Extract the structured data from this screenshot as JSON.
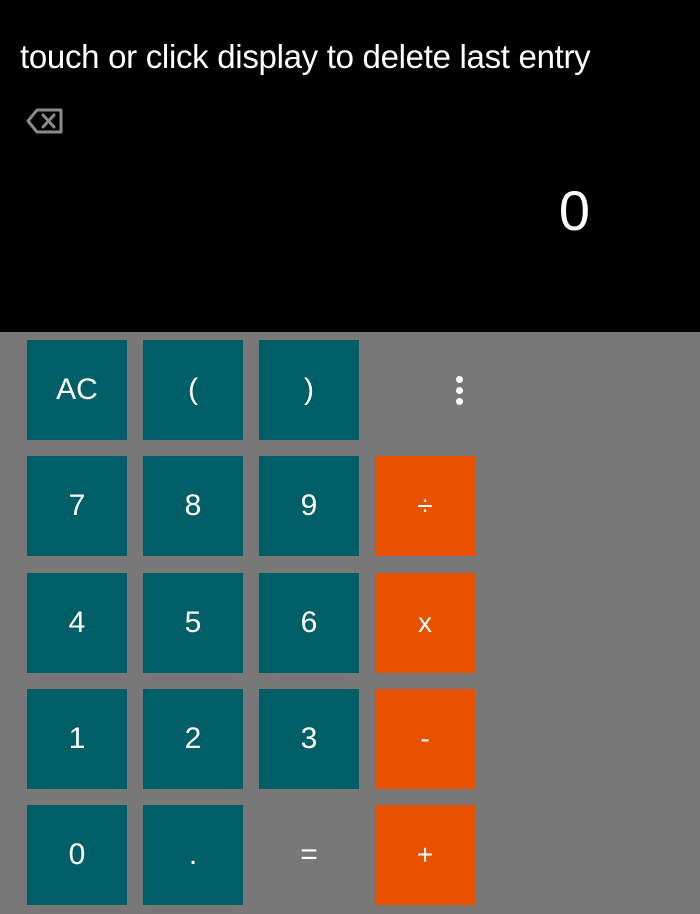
{
  "display": {
    "hint": "touch or click display to delete last entry",
    "value": "0",
    "backspace_icon": "backspace-icon"
  },
  "keys": {
    "ac": "AC",
    "open_paren": "(",
    "close_paren": ")",
    "menu_icon": "more-vert-icon",
    "seven": "7",
    "eight": "8",
    "nine": "9",
    "divide": "÷",
    "four": "4",
    "five": "5",
    "six": "6",
    "multiply": "x",
    "one": "1",
    "two": "2",
    "three": "3",
    "minus": "-",
    "zero": "0",
    "decimal": ".",
    "equals": "=",
    "plus": "+"
  },
  "colors": {
    "display_bg": "#000000",
    "keypad_bg": "#787878",
    "number_key": "#005f66",
    "operator_key": "#e85100",
    "text": "#ffffff"
  }
}
